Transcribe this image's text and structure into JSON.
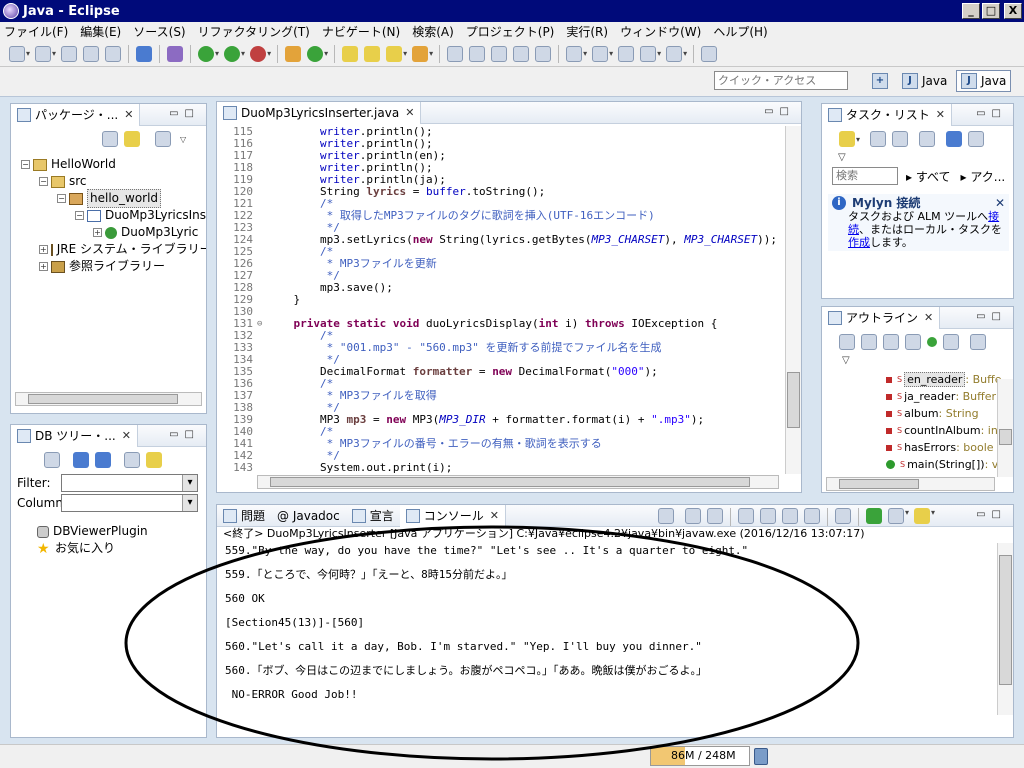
{
  "window": {
    "title": "Java - Eclipse",
    "min": "_",
    "max": "□",
    "close": "X"
  },
  "menu": [
    "ファイル(F)",
    "編集(E)",
    "ソース(S)",
    "リファクタリング(T)",
    "ナビゲート(N)",
    "検索(A)",
    "プロジェクト(P)",
    "実行(R)",
    "ウィンドウ(W)",
    "ヘルプ(H)"
  ],
  "quick_access": {
    "placeholder": "クイック・アクセス"
  },
  "perspectives": [
    "Java",
    "Java"
  ],
  "package_explorer": {
    "tab": "パッケージ・...",
    "tree": {
      "project": "HelloWorld",
      "src": "src",
      "package": "hello_world",
      "file": "DuoMp3LyricsIns",
      "class": "DuoMp3Lyric",
      "jre": "JRE システム・ライブラリー",
      "refs": "参照ライブラリー"
    }
  },
  "db_tree": {
    "tab": "DB ツリー・...",
    "filter_label": "Filter:",
    "column_label": "Column:",
    "plugin": "DBViewerPlugin",
    "favorites": "お気に入り"
  },
  "editor": {
    "tab": "DuoMp3LyricsInserter.java",
    "lines": [
      {
        "n": "115",
        "t": "        writer.println();"
      },
      {
        "n": "116",
        "t": "        writer.println();"
      },
      {
        "n": "117",
        "t": "        writer.println(en);"
      },
      {
        "n": "118",
        "t": "        writer.println();"
      },
      {
        "n": "119",
        "t": "        writer.println(ja);"
      },
      {
        "n": "120",
        "t": "        String lyrics = buffer.toString();"
      },
      {
        "n": "121",
        "t": "        /*"
      },
      {
        "n": "122",
        "t": "         * 取得したMP3ファイルのタグに歌詞を挿入(UTF-16エンコード)"
      },
      {
        "n": "123",
        "t": "         */"
      },
      {
        "n": "124",
        "t": "        mp3.setLyrics(new String(lyrics.getBytes(MP3_CHARSET), MP3_CHARSET));"
      },
      {
        "n": "125",
        "t": "        /*"
      },
      {
        "n": "126",
        "t": "         * MP3ファイルを更新"
      },
      {
        "n": "127",
        "t": "         */"
      },
      {
        "n": "128",
        "t": "        mp3.save();"
      },
      {
        "n": "129",
        "t": "    }"
      },
      {
        "n": "130",
        "t": ""
      },
      {
        "n": "131",
        "t": "    private static void duoLyricsDisplay(int i) throws IOException {"
      },
      {
        "n": "132",
        "t": "        /*"
      },
      {
        "n": "133",
        "t": "         * \"001.mp3\" - \"560.mp3\" を更新する前提でファイル名を生成"
      },
      {
        "n": "134",
        "t": "         */"
      },
      {
        "n": "135",
        "t": "        DecimalFormat formatter = new DecimalFormat(\"000\");"
      },
      {
        "n": "136",
        "t": "        /*"
      },
      {
        "n": "137",
        "t": "         * MP3ファイルを取得"
      },
      {
        "n": "138",
        "t": "         */"
      },
      {
        "n": "139",
        "t": "        MP3 mp3 = new MP3(MP3_DIR + formatter.format(i) + \".mp3\");"
      },
      {
        "n": "140",
        "t": "        /*"
      },
      {
        "n": "141",
        "t": "         * MP3ファイルの番号・エラーの有無・歌詞を表示する"
      },
      {
        "n": "142",
        "t": "         */"
      },
      {
        "n": "143",
        "t": "        System.out.print(i);"
      }
    ]
  },
  "tasks": {
    "tab": "タスク・リスト",
    "search_placeholder": "検索",
    "all": "すべて",
    "activate": "アク...",
    "mylyn_title": "Mylyn 接続",
    "mylyn_text1": "タスクおよび ALM ツールへ",
    "mylyn_link1": "接続",
    "mylyn_text2": "、またはローカル・タスクを",
    "mylyn_link2": "作成",
    "mylyn_text3": "します。"
  },
  "outline": {
    "tab": "アウトライン",
    "items": [
      {
        "name": "en_reader",
        "type": " : Buffe"
      },
      {
        "name": "ja_reader",
        "type": " : Buffer"
      },
      {
        "name": "album",
        "type": " : String"
      },
      {
        "name": "countInAlbum",
        "type": " : in"
      },
      {
        "name": "hasErrors",
        "type": " : boole"
      },
      {
        "name": "main(String[])",
        "type": " : v"
      }
    ]
  },
  "console": {
    "tabs": [
      "問題",
      "@ Javadoc",
      "宣言",
      "コンソール"
    ],
    "header": "<終了> DuoMp3LyricsInserter [Java アプリケーション] C:¥Java¥eclipse4.2¥java¥bin¥javaw.exe (2016/12/16 13:07:17)",
    "lines": [
      "559.\"By the way, do you have the time?\" \"Let's see .. It's a quarter to eight.\"",
      "",
      "559.「ところで、今何時？」「えーと、8時15分前だよ。」",
      "",
      "560 OK",
      "",
      "[Section45(13)]-[560]",
      "",
      "560.\"Let's call it a day, Bob. I'm starved.\" \"Yep. I'll buy you dinner.\"",
      "",
      "560.「ボブ、今日はこの辺までにしましょう。お腹がペコペコ。」「ああ。晩飯は僕がおごるよ。」",
      "",
      " NO-ERROR Good Job!!"
    ]
  },
  "status": {
    "heap": "86M / 248M",
    "heap_fraction": 0.35
  }
}
